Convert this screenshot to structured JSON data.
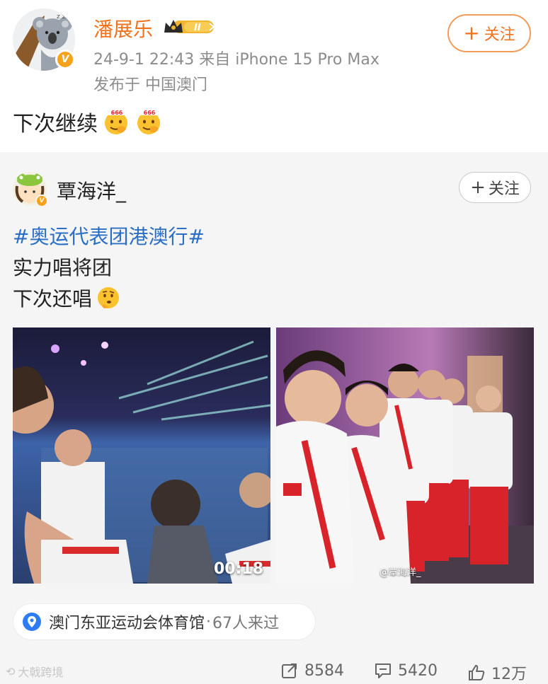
{
  "post": {
    "author": "潘展乐",
    "member_badge": "II",
    "meta": "24-9-1 22:43  来自 iPhone 15 Pro Max",
    "location": "发布于 中国澳门",
    "follow_label": "关注",
    "text": "下次继续",
    "emoji_label": "666"
  },
  "repost": {
    "author": "覃海洋_",
    "follow_label": "关注",
    "hashtag": "#奥运代表团港澳行#",
    "line1": "实力唱将团",
    "line2": "下次还唱",
    "video_duration": "00:18",
    "photo_watermark": "@覃海洋_",
    "location_chip": {
      "name": "澳门东亚运动会体育馆",
      "separator": "·",
      "visitors": "67人来过"
    }
  },
  "footer": {
    "watermark": "大戟跨境",
    "reposts": "8584",
    "comments": "5420",
    "likes": "12万"
  },
  "colors": {
    "author_orange": "#f0721d",
    "hashtag_blue": "#2b6fc4",
    "card_bg": "#f5f5f5"
  },
  "icons": [
    "koala-avatar-icon",
    "verified-badge-icon",
    "crown-badge-icon",
    "666-emoji-icon",
    "thinking-emoji-icon",
    "location-pin-icon",
    "repost-icon",
    "comment-icon",
    "like-icon"
  ]
}
